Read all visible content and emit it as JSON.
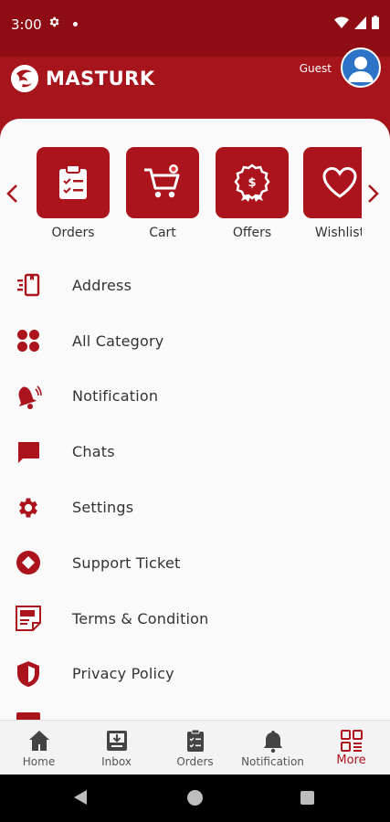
{
  "status_bar": {
    "time": "3:00",
    "icons": [
      "settings-icon",
      "notification-dot-icon",
      "wifi-icon",
      "signal-icon",
      "battery-icon"
    ]
  },
  "header": {
    "brand": "MASTURK",
    "guest_label": "Guest",
    "accent_color": "#a6141c"
  },
  "quick_tiles": [
    {
      "label": "Orders",
      "icon": "clipboard-list-icon"
    },
    {
      "label": "Cart",
      "icon": "cart-icon"
    },
    {
      "label": "Offers",
      "icon": "offer-badge-icon"
    },
    {
      "label": "Wishlist",
      "icon": "heart-icon"
    }
  ],
  "menu": [
    {
      "label": "Address",
      "icon": "address-icon"
    },
    {
      "label": "All Category",
      "icon": "category-grid-icon"
    },
    {
      "label": "Notification",
      "icon": "bell-icon"
    },
    {
      "label": "Chats",
      "icon": "chat-icon"
    },
    {
      "label": "Settings",
      "icon": "gear-icon"
    },
    {
      "label": "Support Ticket",
      "icon": "support-ticket-icon"
    },
    {
      "label": "Terms & Condition",
      "icon": "terms-icon"
    },
    {
      "label": "Privacy Policy",
      "icon": "shield-icon"
    }
  ],
  "bottom_nav": {
    "items": [
      {
        "label": "Home",
        "icon": "home-icon"
      },
      {
        "label": "Inbox",
        "icon": "inbox-icon"
      },
      {
        "label": "Orders",
        "icon": "clipboard-icon"
      },
      {
        "label": "Notification",
        "icon": "bell-icon"
      },
      {
        "label": "More",
        "icon": "grid-more-icon"
      }
    ],
    "active": "More"
  }
}
